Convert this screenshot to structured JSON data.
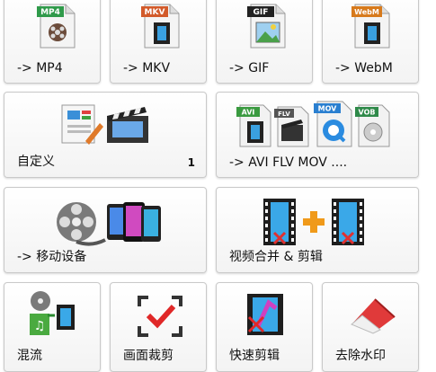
{
  "tiles": {
    "mp4": {
      "label": "-> MP4",
      "format": "MP4",
      "color": "#2f9a4a"
    },
    "mkv": {
      "label": "-> MKV",
      "format": "MKV",
      "color": "#d25a2a"
    },
    "gif": {
      "label": "-> GIF",
      "format": "GIF",
      "color": "#222222"
    },
    "webm": {
      "label": "-> WebM",
      "format": "WebM",
      "color": "#d77a1c"
    },
    "custom": {
      "label": "自定义",
      "badge": "1"
    },
    "multi": {
      "label": "-> AVI FLV MOV ....",
      "formats": [
        "AVI",
        "FLV",
        "MOV",
        "VOB"
      ]
    },
    "mobile": {
      "label": "-> 移动设备"
    },
    "merge": {
      "label": "视频合并 & 剪辑"
    },
    "mux": {
      "label": "混流"
    },
    "crop": {
      "label": "画面裁剪"
    },
    "quickcut": {
      "label": "快速剪辑"
    },
    "watermark": {
      "label": "去除水印"
    }
  }
}
